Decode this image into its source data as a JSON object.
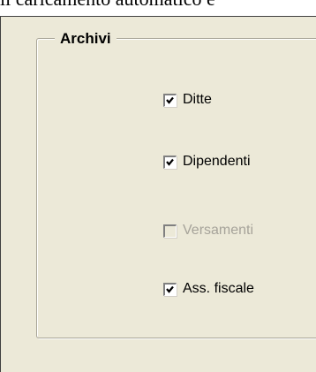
{
  "top_caption": "il caricamento automatico e",
  "group": {
    "title": "Archivi",
    "items": [
      {
        "label": "Ditte",
        "checked": true,
        "enabled": true
      },
      {
        "label": "Dipendenti",
        "checked": true,
        "enabled": true
      },
      {
        "label": "Versamenti",
        "checked": false,
        "enabled": false
      },
      {
        "label": "Ass. fiscale",
        "checked": true,
        "enabled": true
      }
    ]
  }
}
